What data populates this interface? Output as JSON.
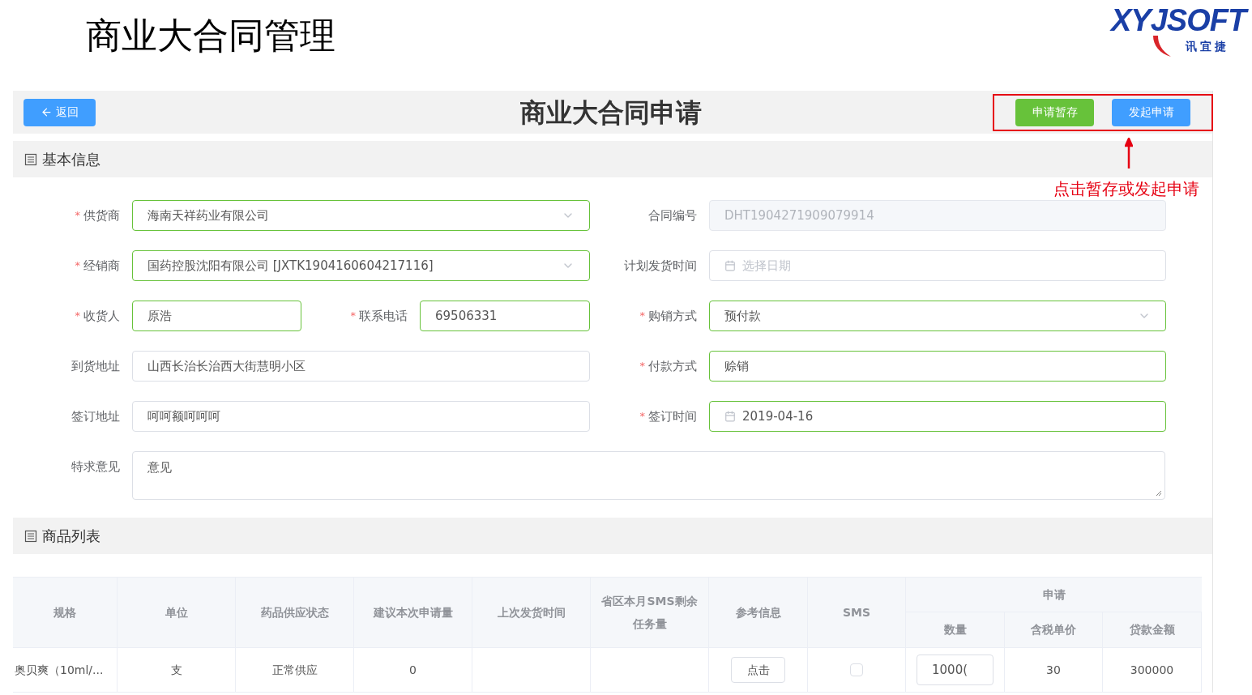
{
  "page_title": "商业大合同管理",
  "logo": {
    "wordmark": "XYJSOFT",
    "subtitle": "讯宜捷"
  },
  "header": {
    "back_button": "返回",
    "title": "商业大合同申请",
    "actions": [
      {
        "label": "申请暂存",
        "kind": "save"
      },
      {
        "label": "发起申请",
        "kind": "submit"
      }
    ]
  },
  "annotation": "点击暂存或发起申请",
  "basic_info": {
    "title": "基本信息",
    "rows": [
      [
        {
          "label": "供货商",
          "required_mark": "*",
          "kind": "select",
          "value": "海南天祥药业有限公司"
        },
        {
          "label": "合同编号",
          "kind": "input",
          "value": "DHT1904271909079914",
          "disabled": true
        }
      ],
      [
        {
          "label": "经销商",
          "required_mark": "*",
          "kind": "select",
          "value": "国药控股沈阳有限公司 [JXTK1904160604217116]"
        },
        {
          "label": "计划发货时间",
          "kind": "date",
          "placeholder": "选择日期"
        }
      ],
      [
        {
          "label": "收货人",
          "required_mark": "*",
          "kind": "input",
          "value": "原浩"
        },
        {
          "label": "联系电话",
          "required_mark": "*",
          "kind": "input",
          "value": "69506331"
        },
        {
          "label": "购销方式",
          "required_mark": "*",
          "kind": "select",
          "value": "预付款"
        }
      ],
      [
        {
          "label": "到货地址",
          "kind": "input",
          "value": "山西长治长治西大街慧明小区"
        },
        {
          "label": "付款方式",
          "required_mark": "*",
          "kind": "input",
          "value": "赊销"
        }
      ],
      [
        {
          "label": "签订地址",
          "kind": "input",
          "value": "呵呵额呵呵呵"
        },
        {
          "label": "签订时间",
          "required_mark": "*",
          "kind": "date",
          "value": "2019-04-16"
        }
      ],
      [
        {
          "label": "特求意见",
          "kind": "textarea",
          "value": "意见"
        }
      ]
    ]
  },
  "goods_list": {
    "title": "商品列表",
    "columns": [
      "规格",
      "单位",
      "药品供应状态",
      "建议本次申请量",
      "上次发货时间",
      "省区本月SMS剩余任务量",
      "参考信息",
      "SMS"
    ],
    "group": {
      "label": "申请",
      "columns": [
        "数量",
        "含税单价",
        "贷款金额"
      ]
    },
    "rows": [
      [
        {
          "kind": "text",
          "text": "奥贝爽（10ml/..."
        },
        {
          "kind": "text",
          "text": "支"
        },
        {
          "kind": "text",
          "text": "正常供应"
        },
        {
          "kind": "text",
          "text": "0"
        },
        {
          "kind": "empty"
        },
        {
          "kind": "empty"
        },
        {
          "kind": "button",
          "text": "点击"
        },
        {
          "kind": "checkbox",
          "checked": false
        },
        {
          "kind": "input",
          "text": "1000("
        },
        {
          "kind": "text",
          "text": "30"
        },
        {
          "kind": "text",
          "text": "300000"
        }
      ]
    ]
  }
}
